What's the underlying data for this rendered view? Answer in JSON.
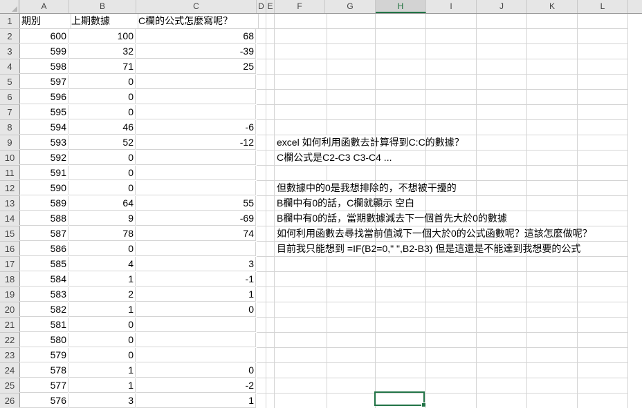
{
  "columns": [
    "A",
    "B",
    "C",
    "D",
    "E",
    "F",
    "G",
    "H",
    "I",
    "J",
    "K",
    "L"
  ],
  "selected_column": "H",
  "rows": [
    {
      "n": "1",
      "a": "期別",
      "b": "上期數據",
      "c": "C欄的公式怎麼寫呢？",
      "f": ""
    },
    {
      "n": "2",
      "a": "600",
      "b": "100",
      "c": "68",
      "f": ""
    },
    {
      "n": "3",
      "a": "599",
      "b": "32",
      "c": "-39",
      "f": ""
    },
    {
      "n": "4",
      "a": "598",
      "b": "71",
      "c": "25",
      "f": ""
    },
    {
      "n": "5",
      "a": "597",
      "b": "0",
      "c": "",
      "f": ""
    },
    {
      "n": "6",
      "a": "596",
      "b": "0",
      "c": "",
      "f": ""
    },
    {
      "n": "7",
      "a": "595",
      "b": "0",
      "c": "",
      "f": ""
    },
    {
      "n": "8",
      "a": "594",
      "b": "46",
      "c": "-6",
      "f": ""
    },
    {
      "n": "9",
      "a": "593",
      "b": "52",
      "c": "-12",
      "f": "excel 如何利用函數去計算得到C:C的數據？"
    },
    {
      "n": "10",
      "a": "592",
      "b": "0",
      "c": "",
      "f": "C欄公式是C2-C3     C3-C4     ..."
    },
    {
      "n": "11",
      "a": "591",
      "b": "0",
      "c": "",
      "f": ""
    },
    {
      "n": "12",
      "a": "590",
      "b": "0",
      "c": "",
      "f": "但數據中的0是我想排除的，不想被干擾的"
    },
    {
      "n": "13",
      "a": "589",
      "b": "64",
      "c": "55",
      "f": "B欄中有0的話，C欄就顯示 空白"
    },
    {
      "n": "14",
      "a": "588",
      "b": "9",
      "c": "-69",
      "f": "B欄中有0的話，當期數據減去下一個首先大於0的數據"
    },
    {
      "n": "15",
      "a": "587",
      "b": "78",
      "c": "74",
      "f": "如何利用函數去尋找當前值減下一個大於0的公式函數呢？這該怎麼做呢？"
    },
    {
      "n": "16",
      "a": "586",
      "b": "0",
      "c": "",
      "f": "目前我只能想到  =IF(B2=0,\" \",B2-B3)  但是這還是不能達到我想要的公式"
    },
    {
      "n": "17",
      "a": "585",
      "b": "4",
      "c": "3",
      "f": ""
    },
    {
      "n": "18",
      "a": "584",
      "b": "1",
      "c": "-1",
      "f": ""
    },
    {
      "n": "19",
      "a": "583",
      "b": "2",
      "c": "1",
      "f": ""
    },
    {
      "n": "20",
      "a": "582",
      "b": "1",
      "c": "0",
      "f": ""
    },
    {
      "n": "21",
      "a": "581",
      "b": "0",
      "c": "",
      "f": ""
    },
    {
      "n": "22",
      "a": "580",
      "b": "0",
      "c": "",
      "f": ""
    },
    {
      "n": "23",
      "a": "579",
      "b": "0",
      "c": "",
      "f": ""
    },
    {
      "n": "24",
      "a": "578",
      "b": "1",
      "c": "0",
      "f": ""
    },
    {
      "n": "25",
      "a": "577",
      "b": "1",
      "c": "-2",
      "f": ""
    },
    {
      "n": "26",
      "a": "576",
      "b": "3",
      "c": "1",
      "f": ""
    }
  ]
}
